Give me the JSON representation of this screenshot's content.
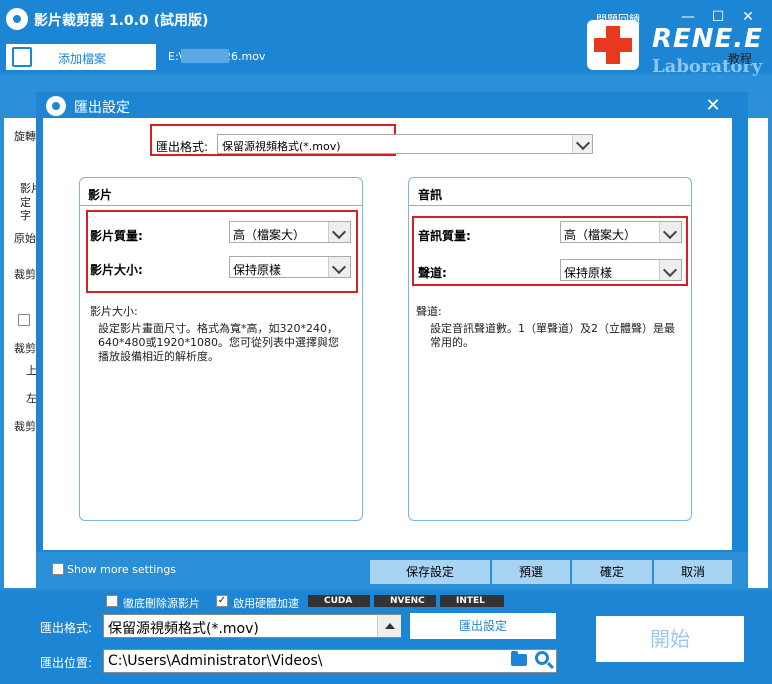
{
  "app": {
    "title": "影片裁剪器 1.0.0 (試用版)",
    "help_label": "問題回饋",
    "file_path": "E:\\P1040326.mov",
    "add_file_label": "添加檔案"
  },
  "brand": {
    "logo_text": "RENE.E",
    "sub_text": "Laboratory",
    "tutorial_label": "教程"
  },
  "left_panel": {
    "items": [
      "旋轉",
      "影片",
      "定",
      "字",
      "原始",
      "裁剪",
      "裁剪",
      "上",
      "左",
      "裁剪"
    ]
  },
  "dialog": {
    "title": "匯出設定",
    "format_label": "匯出格式:",
    "format_value": "保留源視頻格式(*.mov)",
    "video_group": {
      "title": "影片",
      "quality_label": "影片質量:",
      "quality_value": "高（檔案大）",
      "size_label": "影片大小:",
      "size_value": "保持原樣",
      "desc_title": "影片大小:",
      "desc_body": "設定影片畫面尺寸。格式為寬*高，如320*240，640*480或1920*1080。您可從列表中選擇與您播放設備相近的解析度。"
    },
    "audio_group": {
      "title": "音訊",
      "quality_label": "音訊質量:",
      "quality_value": "高（檔案大）",
      "channel_label": "聲道:",
      "channel_value": "保持原樣",
      "desc_title": "聲道:",
      "desc_body": "設定音訊聲道數。1（單聲道）及2（立體聲）是最常用的。"
    },
    "show_more_label": "Show more settings",
    "buttons": {
      "save": "保存設定",
      "preset": "預選",
      "ok": "確定",
      "cancel": "取消"
    }
  },
  "bottom": {
    "delete_source_label": "徹底刪除源影片",
    "hw_accel_label": "啟用硬體加速",
    "gpu_badges": [
      "CUDA",
      "NVENC",
      "INTEL"
    ],
    "export_format_label": "匯出格式:",
    "export_format_value": "保留源視頻格式(*.mov)",
    "export_settings_label": "匯出設定",
    "export_location_label": "匯出位置:",
    "export_location_value": "C:\\Users\\Administrator\\Videos\\",
    "start_label": "開始"
  },
  "colors": {
    "primary": "#1d86d4",
    "highlight_border": "#d42020",
    "dialog_button": "#a9d3f3"
  }
}
